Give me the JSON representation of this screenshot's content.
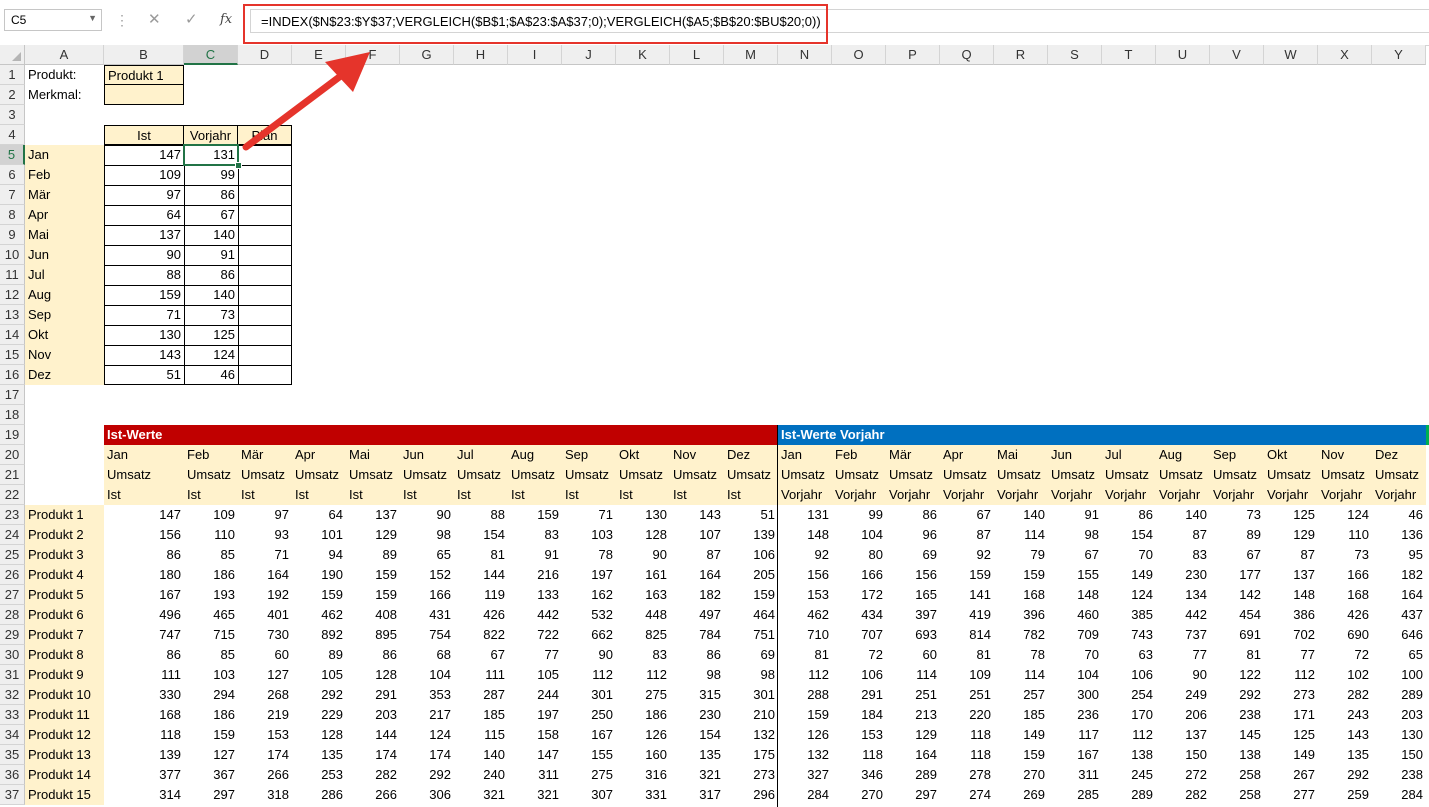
{
  "namebox": "C5",
  "formula": "=INDEX($N$23:$Y$37;VERGLEICH($B$1;$A$23:$A$37;0);VERGLEICH($A5;$B$20:$BU$20;0))",
  "icons": {
    "cancel": "close-icon",
    "enter": "check-icon",
    "fx": "function-icon"
  },
  "colors": {
    "tan": "#fff2cc",
    "red_band": "#c00000",
    "blue_band": "#0070c0",
    "green_band": "#00b050",
    "accent": "#217346",
    "callout": "#e5342b"
  },
  "columns": [
    "A",
    "B",
    "C",
    "D",
    "E",
    "F",
    "G",
    "H",
    "I",
    "J",
    "K",
    "L",
    "M",
    "N",
    "O",
    "P",
    "Q",
    "R",
    "S",
    "T",
    "U",
    "V",
    "W",
    "X",
    "Y"
  ],
  "rows": [
    "1",
    "2",
    "3",
    "4",
    "5",
    "6",
    "7",
    "8",
    "9",
    "10",
    "11",
    "12",
    "13",
    "14",
    "15",
    "16",
    "17",
    "18",
    "19",
    "20",
    "21",
    "22",
    "23",
    "24",
    "25",
    "26",
    "27",
    "28",
    "29",
    "30",
    "31",
    "32",
    "33",
    "34",
    "35",
    "36",
    "37"
  ],
  "top": {
    "produkt_label": "Produkt:",
    "produkt_value": "Produkt 1",
    "merkmal_label": "Merkmal:",
    "merkmal_value": "",
    "headers": [
      "Ist",
      "Vorjahr",
      "Plan"
    ],
    "months": [
      "Jan",
      "Feb",
      "Mär",
      "Apr",
      "Mai",
      "Jun",
      "Jul",
      "Aug",
      "Sep",
      "Okt",
      "Nov",
      "Dez"
    ],
    "ist": [
      147,
      109,
      97,
      64,
      137,
      90,
      88,
      159,
      71,
      130,
      143,
      51
    ],
    "vorjahr": [
      131,
      99,
      86,
      67,
      140,
      91,
      86,
      140,
      73,
      125,
      124,
      46
    ]
  },
  "bottom": {
    "band_ist": "Ist-Werte",
    "band_vorjahr": "Ist-Werte Vorjahr",
    "months": [
      "Jan",
      "Feb",
      "Mär",
      "Apr",
      "Mai",
      "Jun",
      "Jul",
      "Aug",
      "Sep",
      "Okt",
      "Nov",
      "Dez"
    ],
    "row21": "Umsatz",
    "row22_ist": "Ist",
    "row22_vorjahr": "Vorjahr",
    "products": [
      "Produkt 1",
      "Produkt 2",
      "Produkt 3",
      "Produkt 4",
      "Produkt 5",
      "Produkt 6",
      "Produkt 7",
      "Produkt 8",
      "Produkt 9",
      "Produkt 10",
      "Produkt 11",
      "Produkt 12",
      "Produkt 13",
      "Produkt 14",
      "Produkt 15"
    ],
    "ist": [
      [
        147,
        109,
        97,
        64,
        137,
        90,
        88,
        159,
        71,
        130,
        143,
        51
      ],
      [
        156,
        110,
        93,
        101,
        129,
        98,
        154,
        83,
        103,
        128,
        107,
        139
      ],
      [
        86,
        85,
        71,
        94,
        89,
        65,
        81,
        91,
        78,
        90,
        87,
        106
      ],
      [
        180,
        186,
        164,
        190,
        159,
        152,
        144,
        216,
        197,
        161,
        164,
        205
      ],
      [
        167,
        193,
        192,
        159,
        159,
        166,
        119,
        133,
        162,
        163,
        182,
        159
      ],
      [
        496,
        465,
        401,
        462,
        408,
        431,
        426,
        442,
        532,
        448,
        497,
        464
      ],
      [
        747,
        715,
        730,
        892,
        895,
        754,
        822,
        722,
        662,
        825,
        784,
        751
      ],
      [
        86,
        85,
        60,
        89,
        86,
        68,
        67,
        77,
        90,
        83,
        86,
        69
      ],
      [
        111,
        103,
        127,
        105,
        128,
        104,
        111,
        105,
        112,
        112,
        98,
        98
      ],
      [
        330,
        294,
        268,
        292,
        291,
        353,
        287,
        244,
        301,
        275,
        315,
        301
      ],
      [
        168,
        186,
        219,
        229,
        203,
        217,
        185,
        197,
        250,
        186,
        230,
        210
      ],
      [
        118,
        159,
        153,
        128,
        144,
        124,
        115,
        158,
        167,
        126,
        154,
        132
      ],
      [
        139,
        127,
        174,
        135,
        174,
        174,
        140,
        147,
        155,
        160,
        135,
        175
      ],
      [
        377,
        367,
        266,
        253,
        282,
        292,
        240,
        311,
        275,
        316,
        321,
        273
      ],
      [
        314,
        297,
        318,
        286,
        266,
        306,
        321,
        321,
        307,
        331,
        317,
        296
      ]
    ],
    "vorjahr": [
      [
        131,
        99,
        86,
        67,
        140,
        91,
        86,
        140,
        73,
        125,
        124,
        46
      ],
      [
        148,
        104,
        96,
        87,
        114,
        98,
        154,
        87,
        89,
        129,
        110,
        136
      ],
      [
        92,
        80,
        69,
        92,
        79,
        67,
        70,
        83,
        67,
        87,
        73,
        95
      ],
      [
        156,
        166,
        156,
        159,
        159,
        155,
        149,
        230,
        177,
        137,
        166,
        182
      ],
      [
        153,
        172,
        165,
        141,
        168,
        148,
        124,
        134,
        142,
        148,
        168,
        164
      ],
      [
        462,
        434,
        397,
        419,
        396,
        460,
        385,
        442,
        454,
        386,
        426,
        437
      ],
      [
        710,
        707,
        693,
        814,
        782,
        709,
        743,
        737,
        691,
        702,
        690,
        646
      ],
      [
        81,
        72,
        60,
        81,
        78,
        70,
        63,
        77,
        81,
        77,
        72,
        65
      ],
      [
        112,
        106,
        114,
        109,
        114,
        104,
        106,
        90,
        122,
        112,
        102,
        100
      ],
      [
        288,
        291,
        251,
        251,
        257,
        300,
        254,
        249,
        292,
        273,
        282,
        289
      ],
      [
        159,
        184,
        213,
        220,
        185,
        236,
        170,
        206,
        238,
        171,
        243,
        203
      ],
      [
        126,
        153,
        129,
        118,
        149,
        117,
        112,
        137,
        145,
        125,
        143,
        130
      ],
      [
        132,
        118,
        164,
        118,
        159,
        167,
        138,
        150,
        138,
        149,
        135,
        150
      ],
      [
        327,
        346,
        289,
        278,
        270,
        311,
        245,
        272,
        258,
        267,
        292,
        238
      ],
      [
        284,
        270,
        297,
        274,
        269,
        285,
        289,
        282,
        258,
        277,
        259,
        284
      ]
    ]
  }
}
